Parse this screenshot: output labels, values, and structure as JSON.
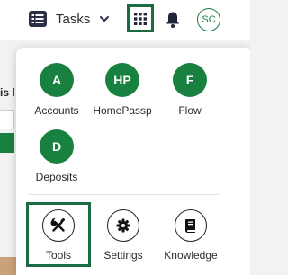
{
  "topbar": {
    "tasks_label": "Tasks",
    "tasks_icon": "list-icon",
    "chevron_icon": "chevron-down-icon",
    "apps_icon": "grid-icon",
    "bell_icon": "bell-icon",
    "avatar_initials": "SC",
    "accent_color": "#1b6b42"
  },
  "background": {
    "peek_text": "is l"
  },
  "apps_panel": {
    "apps": [
      {
        "initials": "A",
        "label": "Accounts"
      },
      {
        "initials": "HP",
        "label": "HomePassp"
      },
      {
        "initials": "F",
        "label": "Flow"
      },
      {
        "initials": "D",
        "label": "Deposits"
      }
    ],
    "tools": [
      {
        "label": "Tools",
        "icon": "tools-icon",
        "highlighted": true
      },
      {
        "label": "Settings",
        "icon": "gear-icon",
        "highlighted": false
      },
      {
        "label": "Knowledge",
        "icon": "book-icon",
        "highlighted": false
      }
    ],
    "app_color": "#19813f"
  }
}
